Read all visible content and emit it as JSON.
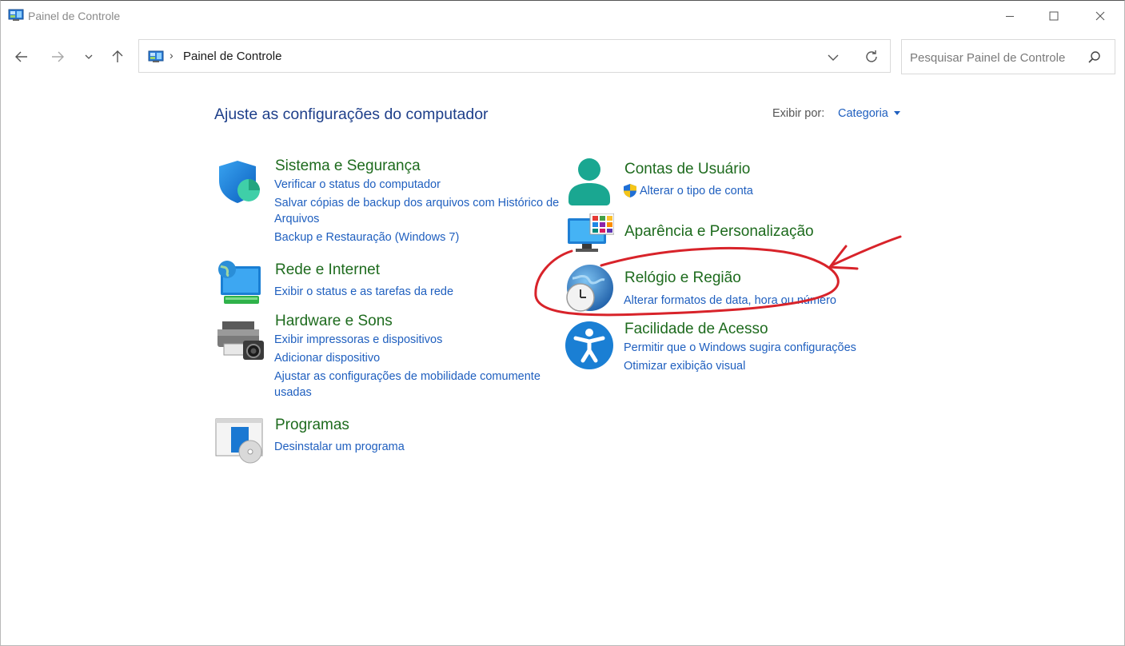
{
  "window": {
    "title": "Painel de Controle"
  },
  "address_bar": {
    "path": "Painel de Controle"
  },
  "search": {
    "placeholder": "Pesquisar Painel de Controle"
  },
  "main": {
    "heading": "Ajuste as configurações do computador",
    "view_by_label": "Exibir por:",
    "view_by_value": "Categoria"
  },
  "categories": {
    "system": {
      "title": "Sistema e Segurança",
      "links": [
        "Verificar o status do computador",
        "Salvar cópias de backup dos arquivos com Histórico de Arquivos",
        "Backup e Restauração (Windows 7)"
      ]
    },
    "network": {
      "title": "Rede e Internet",
      "links": [
        "Exibir o status e as tarefas da rede"
      ]
    },
    "hardware": {
      "title": "Hardware e Sons",
      "links": [
        "Exibir impressoras e dispositivos",
        "Adicionar dispositivo",
        "Ajustar as configurações de mobilidade comumente usadas"
      ]
    },
    "programs": {
      "title": "Programas",
      "links": [
        "Desinstalar um programa"
      ]
    },
    "accounts": {
      "title": "Contas de Usuário",
      "links": [
        "Alterar o tipo de conta"
      ]
    },
    "appearance": {
      "title": "Aparência e Personalização"
    },
    "clock": {
      "title": "Relógio e Região",
      "links": [
        "Alterar formatos de data, hora ou número"
      ]
    },
    "access": {
      "title": "Facilidade de Acesso",
      "links": [
        "Permitir que o Windows sugira configurações",
        "Otimizar exibição visual"
      ]
    }
  },
  "colors": {
    "heading": "#1e3f8a",
    "category_title": "#1e6b1e",
    "link": "#1f5fbf",
    "annotation": "#d8232a"
  },
  "icons": {
    "title_bar": "control-panel-icon",
    "system": "shield-icon",
    "network": "network-globe-icon",
    "hardware": "printer-camera-icon",
    "programs": "programs-disc-icon",
    "accounts": "user-icon",
    "appearance": "monitor-palette-icon",
    "clock": "globe-clock-icon",
    "access": "accessibility-icon"
  }
}
